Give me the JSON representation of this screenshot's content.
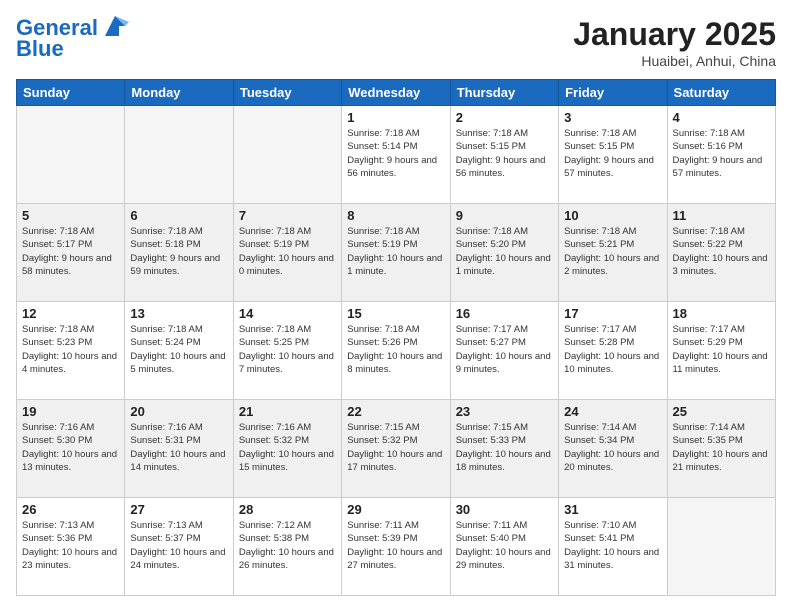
{
  "header": {
    "logo_line1": "General",
    "logo_line2": "Blue",
    "month": "January 2025",
    "location": "Huaibei, Anhui, China"
  },
  "weekdays": [
    "Sunday",
    "Monday",
    "Tuesday",
    "Wednesday",
    "Thursday",
    "Friday",
    "Saturday"
  ],
  "weeks": [
    [
      {
        "day": null,
        "info": null
      },
      {
        "day": null,
        "info": null
      },
      {
        "day": null,
        "info": null
      },
      {
        "day": "1",
        "info": "Sunrise: 7:18 AM\nSunset: 5:14 PM\nDaylight: 9 hours\nand 56 minutes."
      },
      {
        "day": "2",
        "info": "Sunrise: 7:18 AM\nSunset: 5:15 PM\nDaylight: 9 hours\nand 56 minutes."
      },
      {
        "day": "3",
        "info": "Sunrise: 7:18 AM\nSunset: 5:15 PM\nDaylight: 9 hours\nand 57 minutes."
      },
      {
        "day": "4",
        "info": "Sunrise: 7:18 AM\nSunset: 5:16 PM\nDaylight: 9 hours\nand 57 minutes."
      }
    ],
    [
      {
        "day": "5",
        "info": "Sunrise: 7:18 AM\nSunset: 5:17 PM\nDaylight: 9 hours\nand 58 minutes."
      },
      {
        "day": "6",
        "info": "Sunrise: 7:18 AM\nSunset: 5:18 PM\nDaylight: 9 hours\nand 59 minutes."
      },
      {
        "day": "7",
        "info": "Sunrise: 7:18 AM\nSunset: 5:19 PM\nDaylight: 10 hours\nand 0 minutes."
      },
      {
        "day": "8",
        "info": "Sunrise: 7:18 AM\nSunset: 5:19 PM\nDaylight: 10 hours\nand 1 minute."
      },
      {
        "day": "9",
        "info": "Sunrise: 7:18 AM\nSunset: 5:20 PM\nDaylight: 10 hours\nand 1 minute."
      },
      {
        "day": "10",
        "info": "Sunrise: 7:18 AM\nSunset: 5:21 PM\nDaylight: 10 hours\nand 2 minutes."
      },
      {
        "day": "11",
        "info": "Sunrise: 7:18 AM\nSunset: 5:22 PM\nDaylight: 10 hours\nand 3 minutes."
      }
    ],
    [
      {
        "day": "12",
        "info": "Sunrise: 7:18 AM\nSunset: 5:23 PM\nDaylight: 10 hours\nand 4 minutes."
      },
      {
        "day": "13",
        "info": "Sunrise: 7:18 AM\nSunset: 5:24 PM\nDaylight: 10 hours\nand 5 minutes."
      },
      {
        "day": "14",
        "info": "Sunrise: 7:18 AM\nSunset: 5:25 PM\nDaylight: 10 hours\nand 7 minutes."
      },
      {
        "day": "15",
        "info": "Sunrise: 7:18 AM\nSunset: 5:26 PM\nDaylight: 10 hours\nand 8 minutes."
      },
      {
        "day": "16",
        "info": "Sunrise: 7:17 AM\nSunset: 5:27 PM\nDaylight: 10 hours\nand 9 minutes."
      },
      {
        "day": "17",
        "info": "Sunrise: 7:17 AM\nSunset: 5:28 PM\nDaylight: 10 hours\nand 10 minutes."
      },
      {
        "day": "18",
        "info": "Sunrise: 7:17 AM\nSunset: 5:29 PM\nDaylight: 10 hours\nand 11 minutes."
      }
    ],
    [
      {
        "day": "19",
        "info": "Sunrise: 7:16 AM\nSunset: 5:30 PM\nDaylight: 10 hours\nand 13 minutes."
      },
      {
        "day": "20",
        "info": "Sunrise: 7:16 AM\nSunset: 5:31 PM\nDaylight: 10 hours\nand 14 minutes."
      },
      {
        "day": "21",
        "info": "Sunrise: 7:16 AM\nSunset: 5:32 PM\nDaylight: 10 hours\nand 15 minutes."
      },
      {
        "day": "22",
        "info": "Sunrise: 7:15 AM\nSunset: 5:32 PM\nDaylight: 10 hours\nand 17 minutes."
      },
      {
        "day": "23",
        "info": "Sunrise: 7:15 AM\nSunset: 5:33 PM\nDaylight: 10 hours\nand 18 minutes."
      },
      {
        "day": "24",
        "info": "Sunrise: 7:14 AM\nSunset: 5:34 PM\nDaylight: 10 hours\nand 20 minutes."
      },
      {
        "day": "25",
        "info": "Sunrise: 7:14 AM\nSunset: 5:35 PM\nDaylight: 10 hours\nand 21 minutes."
      }
    ],
    [
      {
        "day": "26",
        "info": "Sunrise: 7:13 AM\nSunset: 5:36 PM\nDaylight: 10 hours\nand 23 minutes."
      },
      {
        "day": "27",
        "info": "Sunrise: 7:13 AM\nSunset: 5:37 PM\nDaylight: 10 hours\nand 24 minutes."
      },
      {
        "day": "28",
        "info": "Sunrise: 7:12 AM\nSunset: 5:38 PM\nDaylight: 10 hours\nand 26 minutes."
      },
      {
        "day": "29",
        "info": "Sunrise: 7:11 AM\nSunset: 5:39 PM\nDaylight: 10 hours\nand 27 minutes."
      },
      {
        "day": "30",
        "info": "Sunrise: 7:11 AM\nSunset: 5:40 PM\nDaylight: 10 hours\nand 29 minutes."
      },
      {
        "day": "31",
        "info": "Sunrise: 7:10 AM\nSunset: 5:41 PM\nDaylight: 10 hours\nand 31 minutes."
      },
      {
        "day": null,
        "info": null
      }
    ]
  ]
}
